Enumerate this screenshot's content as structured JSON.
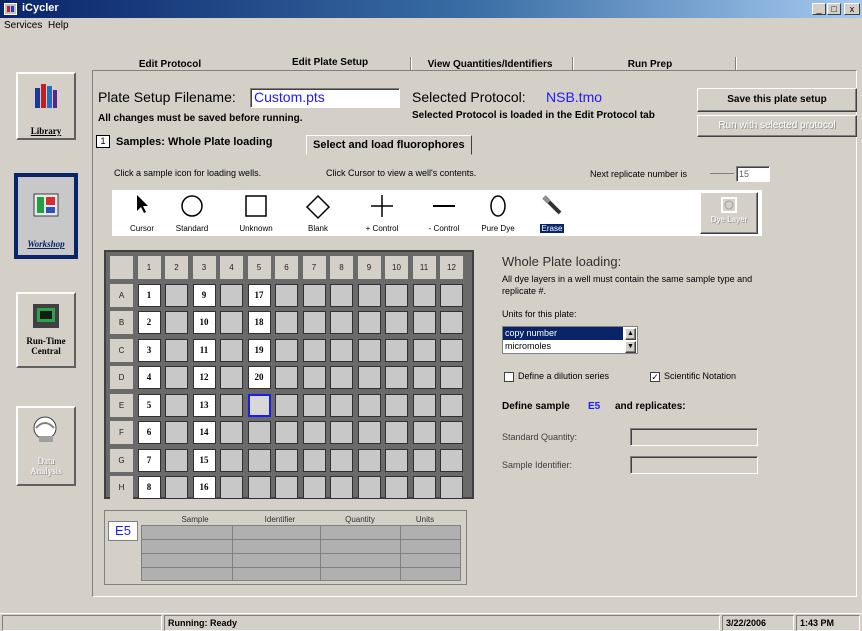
{
  "window": {
    "title": "iCycler",
    "min": "_",
    "max": "□",
    "close": "x"
  },
  "menu": [
    "Services",
    "Help"
  ],
  "nav": [
    {
      "label": "Library",
      "icon": "books-icon"
    },
    {
      "label": "Workshop",
      "icon": "workshop-icon"
    },
    {
      "label": "Run-Time\nCentral",
      "icon": "thermal-cycler-icon"
    },
    {
      "label": "Data\nAnalysis",
      "icon": "data-analysis-icon"
    }
  ],
  "tabs": [
    "Edit Protocol",
    "Edit Plate Setup",
    "View Quantities/Identifiers",
    "Run Prep"
  ],
  "header": {
    "filename_label": "Plate Setup Filename:",
    "filename_value": "Custom.pts",
    "protocol_label": "Selected Protocol:",
    "protocol_value": "NSB.tmo",
    "save_note": "All changes must be saved before running.",
    "protocol_note": "Selected Protocol is loaded in the Edit Protocol tab",
    "save_button": "Save this plate setup",
    "run_button": "Run with selected protocol"
  },
  "subtabs": {
    "num": "1",
    "tab1": "Samples: Whole Plate loading",
    "tab2": "Select and load fluorophores"
  },
  "instructions": {
    "left": "Click a sample icon for loading wells.",
    "mid": "Click Cursor to view a well's contents.",
    "replicate_label": "Next replicate number is",
    "replicate_value": "15"
  },
  "tools": [
    "Cursor",
    "Standard",
    "Unknown",
    "Blank",
    "+ Control",
    "- Control",
    "Pure Dye",
    "Erase"
  ],
  "dye_layer_button": "Dye Layer",
  "plate": {
    "cols": [
      "1",
      "2",
      "3",
      "4",
      "5",
      "6",
      "7",
      "8",
      "9",
      "10",
      "11",
      "12"
    ],
    "rows": [
      "A",
      "B",
      "C",
      "D",
      "E",
      "F",
      "G",
      "H"
    ],
    "col1": [
      "1",
      "2",
      "3",
      "4",
      "5",
      "6",
      "7",
      "8"
    ],
    "col3": [
      "9",
      "10",
      "11",
      "12",
      "13",
      "14",
      "15",
      "16"
    ],
    "col5": [
      "17",
      "18",
      "19",
      "20"
    ]
  },
  "info_table": {
    "well": "E5",
    "headers": [
      "Sample",
      "Identifier",
      "Quantity",
      "Units"
    ]
  },
  "right_panel": {
    "heading": "Whole Plate loading:",
    "desc": "All dye layers in a well must contain the same sample type and replicate #.",
    "units_label": "Units for this plate:",
    "units_options": [
      "copy number",
      "micromoles"
    ],
    "dilution_label": "Define a dilution series",
    "dilution_checked": false,
    "sci_label": "Scientific Notation",
    "sci_checked": true,
    "define_prefix": "Define sample",
    "define_well": "E5",
    "define_suffix": "and replicates:",
    "std_qty_label": "Standard Quantity:",
    "sample_id_label": "Sample Identifier:"
  },
  "status": {
    "text": "Running: Ready",
    "date": "3/22/2006",
    "time": "1:43 PM"
  },
  "colors": {
    "title_start": "#0a246a",
    "title_end": "#a6caf0",
    "accent_blue": "#1a1aff",
    "face": "#d4d0c8"
  }
}
